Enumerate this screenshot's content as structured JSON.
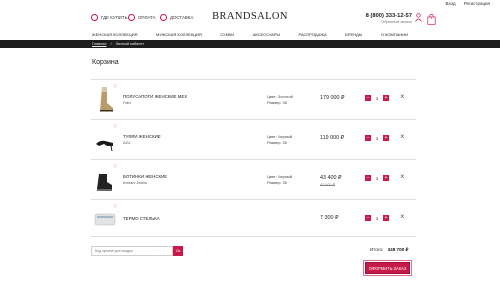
{
  "top_links": {
    "login": "Вход",
    "register": "Регистрация"
  },
  "header": {
    "where_to_buy": "Где купить",
    "payment": "Оплата",
    "delivery": "Доставка",
    "logo": "BRANDSALON",
    "phone": "8 (800) 333-12-57",
    "callback": "Обратный звонок",
    "cart_count": "1"
  },
  "nav": {
    "items": [
      "Женская коллекция",
      "Мужская коллекция",
      "Сумки",
      "Аксессуары",
      "Распродажа",
      "Бренды",
      "О компании"
    ]
  },
  "breadcrumb": {
    "home": "Главная",
    "separator": "/",
    "current": "Личный кабинет"
  },
  "page_title": "Корзина",
  "cart": {
    "items": [
      {
        "name": "Полусапоги женские мех",
        "brand": "Fabi",
        "color": "Цвет: Золотой",
        "size": "Размер: 36",
        "price": "179 000 ₽",
        "old_price": "",
        "qty": "1"
      },
      {
        "name": "Туфли женские",
        "brand": "AGL",
        "color": "Цвет: Черный",
        "size": "Размер: 35",
        "price": "119 000 ₽",
        "old_price": "",
        "qty": "1"
      },
      {
        "name": "Ботинки женские",
        "brand": "Armani Jeans",
        "color": "Цвет: Черный",
        "size": "Размер: 36",
        "price": "43 400 ₽",
        "old_price": "62 000 ₽",
        "qty": "1"
      },
      {
        "name": "Термо стелька",
        "brand": "",
        "color": "",
        "size": "",
        "price": "7 300 ₽",
        "old_price": "",
        "qty": "1"
      }
    ],
    "minus": "−",
    "plus": "+",
    "remove": "×"
  },
  "coupon": {
    "placeholder": "Код купона для скидки",
    "button": "Ок"
  },
  "total": {
    "label": "Итого:",
    "value": "348 700 ₽"
  },
  "checkout_label": "Оформить заказ",
  "colors": {
    "accent": "#c8194b",
    "bar": "#1d1d1d"
  }
}
